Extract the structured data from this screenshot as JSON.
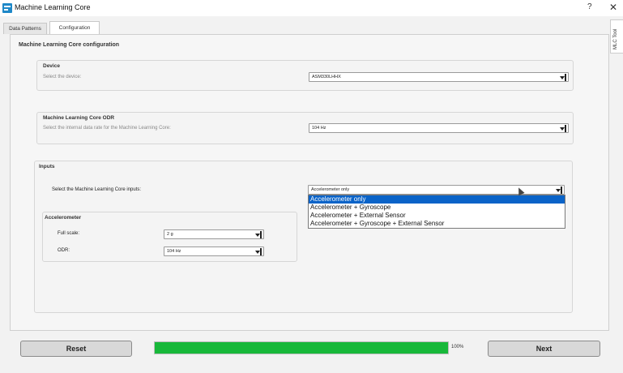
{
  "window": {
    "title": "Machine Learning Core",
    "help": "?",
    "close": "✕"
  },
  "tabs": [
    {
      "label": "Data Patterns",
      "active": false
    },
    {
      "label": "Configuration",
      "active": true
    }
  ],
  "side_tab": "MLC Tool",
  "config": {
    "title": "Machine Learning Core configuration",
    "device": {
      "title": "Device",
      "hint": "Select the device:",
      "value": "ASM330LHHX"
    },
    "odr": {
      "title": "Machine Learning Core ODR",
      "hint": "Select the internal data rate for the Machine Learning Core:",
      "value": "104 Hz"
    },
    "inputs": {
      "title": "Inputs",
      "label": "Select the Machine Learning Core inputs:",
      "value": "Accelerometer only",
      "options": [
        "Accelerometer only",
        "Accelerometer + Gyroscope",
        "Accelerometer + External Sensor",
        "Accelerometer + Gyroscope + External Sensor"
      ],
      "selected_index": 0
    },
    "accelerometer": {
      "title": "Accelerometer",
      "full_scale_label": "Full scale:",
      "full_scale_value": "2 g",
      "odr_label": "ODR:",
      "odr_value": "104 Hz"
    }
  },
  "footer": {
    "reset_label": "Reset",
    "next_label": "Next",
    "progress_percent": 100,
    "progress_text": "100%",
    "progress_color": "#18b83a"
  }
}
